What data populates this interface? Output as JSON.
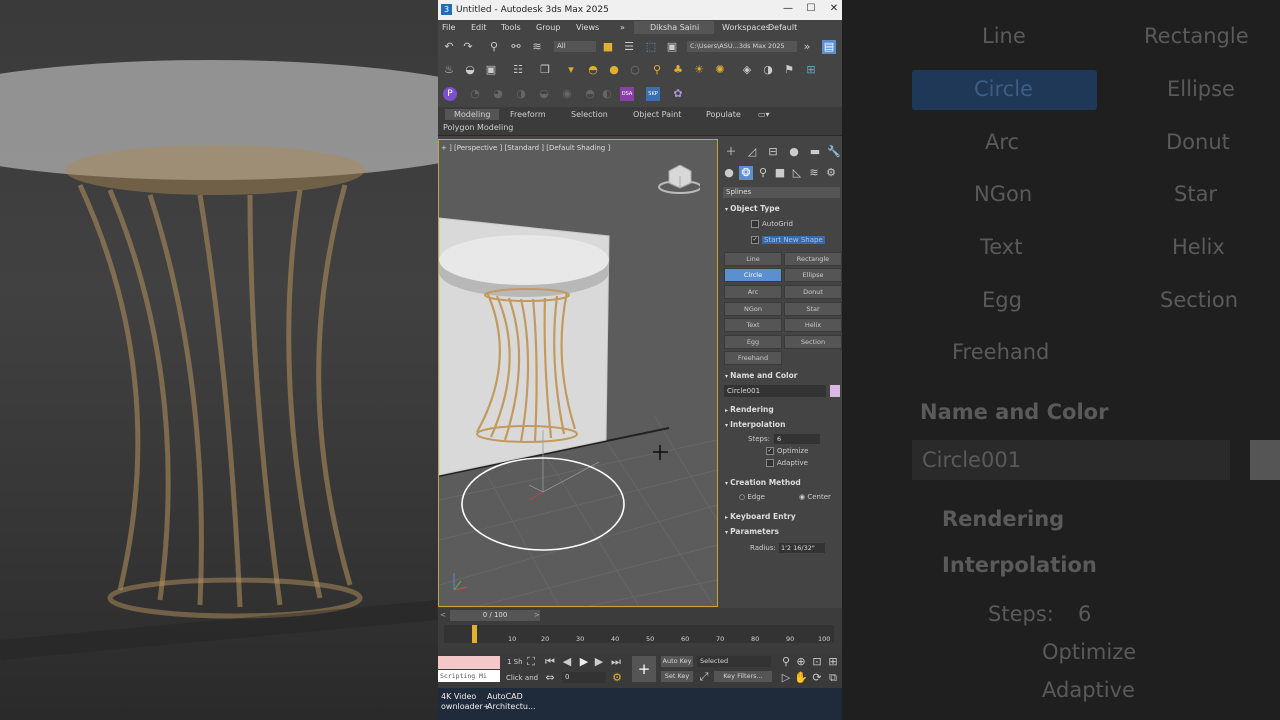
{
  "window": {
    "title": "Untitled - Autodesk 3ds Max 2025",
    "icon_color": "#1e6fb8"
  },
  "menu": {
    "items": [
      "File",
      "Edit",
      "Tools",
      "Group",
      "Views"
    ],
    "more": "»",
    "user": "Diksha Saini",
    "workspaces_label": "Workspaces:",
    "workspace": "Default"
  },
  "toolbar": {
    "selection_filter": "All",
    "path": "C:\\Users\\ASU...3ds Max 2025"
  },
  "ribbon": {
    "tabs": [
      "Modeling",
      "Freeform",
      "Selection",
      "Object Paint",
      "Populate"
    ],
    "sub": "Polygon Modeling"
  },
  "viewport": {
    "label": "+ ] [Perspective ] [Standard ] [Default Shading ]"
  },
  "panel": {
    "category": "Splines",
    "object_type": {
      "title": "Object Type",
      "autogrid": "AutoGrid",
      "start_new_shape": "Start New Shape",
      "buttons": [
        {
          "label": "Line",
          "active": false
        },
        {
          "label": "Rectangle",
          "active": false
        },
        {
          "label": "Circle",
          "active": true
        },
        {
          "label": "Ellipse",
          "active": false
        },
        {
          "label": "Arc",
          "active": false
        },
        {
          "label": "Donut",
          "active": false
        },
        {
          "label": "NGon",
          "active": false
        },
        {
          "label": "Star",
          "active": false
        },
        {
          "label": "Text",
          "active": false
        },
        {
          "label": "Helix",
          "active": false
        },
        {
          "label": "Egg",
          "active": false
        },
        {
          "label": "Section",
          "active": false
        },
        {
          "label": "Freehand",
          "active": false
        }
      ]
    },
    "name_color": {
      "title": "Name and Color",
      "name": "Circle001",
      "color": "#d9b8e6"
    },
    "rendering": {
      "title": "Rendering"
    },
    "interpolation": {
      "title": "Interpolation",
      "steps_label": "Steps:",
      "steps": "6",
      "optimize": "Optimize",
      "adaptive": "Adaptive"
    },
    "creation_method": {
      "title": "Creation Method",
      "edge": "Edge",
      "center": "Center"
    },
    "keyboard_entry": {
      "title": "Keyboard Entry"
    },
    "parameters": {
      "title": "Parameters",
      "radius_label": "Radius:",
      "radius": "1'2 16/32\""
    }
  },
  "timeline": {
    "frame": "0 / 100",
    "ticks": [
      "10",
      "20",
      "30",
      "40",
      "50",
      "60",
      "70",
      "80",
      "90",
      "100"
    ]
  },
  "status": {
    "script": "Scripting Mi",
    "sh": "1 Sh",
    "hint": "Click and",
    "frame_value": "0",
    "auto_key": "Auto Key",
    "set_key": "Set Key",
    "selected": "Selected",
    "key_filters": "Key Filters..."
  },
  "taskbar": {
    "items": [
      "4K Video\nownloader+",
      "AutoCAD\nArchitectu..."
    ]
  },
  "zoomed": {
    "buttons": [
      "Line",
      "Rectangle",
      "Circle",
      "Ellipse",
      "Arc",
      "Donut",
      "NGon",
      "Star",
      "Text",
      "Helix",
      "Egg",
      "Section",
      "Freehand"
    ],
    "name_color": "Name and Color",
    "name": "Circle001",
    "rendering": "Rendering",
    "interpolation": "Interpolation",
    "steps_label": "Steps:",
    "steps": "6",
    "optimize": "Optimize",
    "adaptive": "Adaptive"
  }
}
